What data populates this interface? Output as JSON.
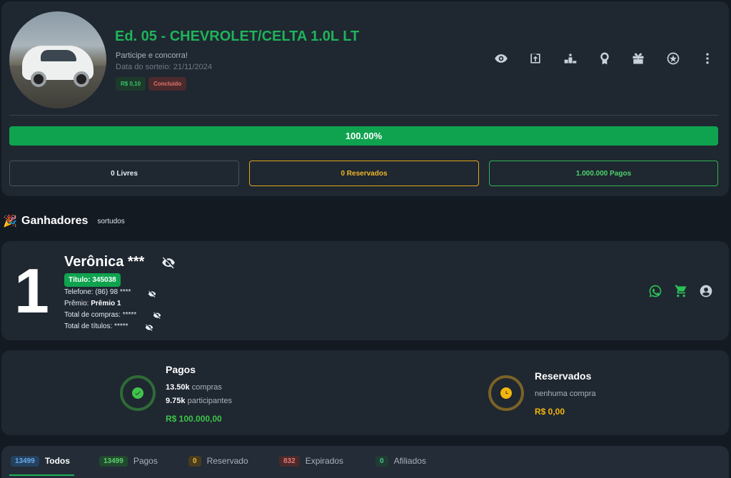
{
  "header": {
    "title": "Ed. 05 - CHEVROLET/CELTA 1.0L LT",
    "subtitle": "Participe e concorra!",
    "draw_date": "Data do sorteio: 21/11/2024",
    "price_badge": "R$ 0,10",
    "status_badge": "Concluído",
    "icons": [
      "eye-icon",
      "share-icon",
      "podium-icon",
      "award-icon",
      "gift-icon",
      "wheel-icon",
      "more-vert-icon"
    ]
  },
  "progress": {
    "value": 1.0,
    "label": "100.00%"
  },
  "stats": {
    "livres": "0 Livres",
    "reservados": "0 Reservados",
    "pagos": "1.000.000 Pagos"
  },
  "winners_section": {
    "title": "Ganhadores",
    "subtitle": "sortudos"
  },
  "winner": {
    "place": "1",
    "name": "Verônica ***",
    "titulo": "Título: 345038",
    "telefone_label": "Telefone:",
    "telefone_value": "(86) 98 ****",
    "premio_label": "Prêmio:",
    "premio_value": "Prêmio 1",
    "total_compras_label": "Total de compras:",
    "total_compras_value": "*****",
    "total_titulos_label": "Total de títulos:",
    "total_titulos_value": "*****"
  },
  "summary": {
    "pagos": {
      "title": "Pagos",
      "compras_count": "13.50k",
      "compras_label": "compras",
      "participantes_count": "9.75k",
      "participantes_label": "participantes",
      "amount": "R$ 100.000,00",
      "color": "#3ec44a"
    },
    "reservados": {
      "title": "Reservados",
      "status": "nenhuma compra",
      "amount": "R$ 0,00",
      "color": "#f2b50d"
    }
  },
  "tabs": [
    {
      "count": "13499",
      "label": "Todos",
      "active": true
    },
    {
      "count": "13499",
      "label": "Pagos"
    },
    {
      "count": "0",
      "label": "Reservado"
    },
    {
      "count": "832",
      "label": "Expirados"
    },
    {
      "count": "0",
      "label": "Afiliados"
    }
  ]
}
